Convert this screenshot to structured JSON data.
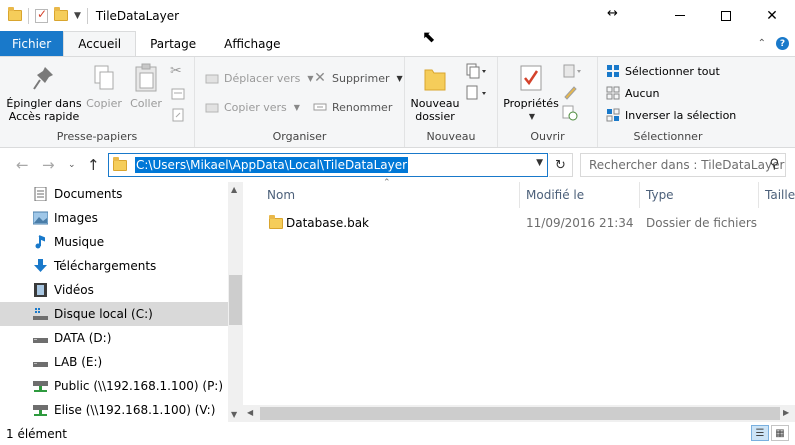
{
  "window": {
    "title": "TileDataLayer",
    "resize_glyph": "↔",
    "close_glyph": "✕"
  },
  "tabs": {
    "file": "Fichier",
    "home": "Accueil",
    "share": "Partage",
    "view": "Affichage",
    "collapse_glyph": "⌃",
    "help_glyph": "?"
  },
  "ribbon": {
    "clipboard": {
      "label": "Presse-papiers",
      "pin_line1": "Épingler dans",
      "pin_line2": "Accès rapide",
      "copy": "Copier",
      "paste": "Coller"
    },
    "organize": {
      "label": "Organiser",
      "move_to": "Déplacer vers",
      "copy_to": "Copier vers",
      "delete": "Supprimer",
      "rename": "Renommer"
    },
    "new": {
      "label": "Nouveau",
      "new_folder_line1": "Nouveau",
      "new_folder_line2": "dossier"
    },
    "open": {
      "label": "Ouvrir",
      "properties": "Propriétés"
    },
    "select": {
      "label": "Sélectionner",
      "select_all": "Sélectionner tout",
      "select_none": "Aucun",
      "invert": "Inverser la sélection"
    }
  },
  "address": {
    "path": "C:\\Users\\Mikael\\AppData\\Local\\TileDataLayer",
    "search_placeholder": "Rechercher dans : TileDataLayer"
  },
  "nav": {
    "items": [
      {
        "label": "Documents",
        "icon": "documents-icon"
      },
      {
        "label": "Images",
        "icon": "pictures-icon"
      },
      {
        "label": "Musique",
        "icon": "music-icon"
      },
      {
        "label": "Téléchargements",
        "icon": "downloads-icon"
      },
      {
        "label": "Vidéos",
        "icon": "videos-icon"
      },
      {
        "label": "Disque local (C:)",
        "icon": "local-disk-icon"
      },
      {
        "label": "DATA (D:)",
        "icon": "drive-icon"
      },
      {
        "label": "LAB (E:)",
        "icon": "drive-icon"
      },
      {
        "label": "Public (\\\\192.168.1.100) (P:)",
        "icon": "network-drive-icon"
      },
      {
        "label": "Elise (\\\\192.168.1.100) (V:)",
        "icon": "network-drive-icon"
      }
    ],
    "selected_index": 5
  },
  "columns": {
    "name": "Nom",
    "modified": "Modifié le",
    "type": "Type",
    "size": "Taille"
  },
  "files": [
    {
      "name": "Database.bak",
      "modified": "11/09/2016 21:34",
      "type": "Dossier de fichiers"
    }
  ],
  "status": {
    "count": "1 élément"
  },
  "colors": {
    "accent": "#1979ca",
    "selection": "#0078d7"
  }
}
